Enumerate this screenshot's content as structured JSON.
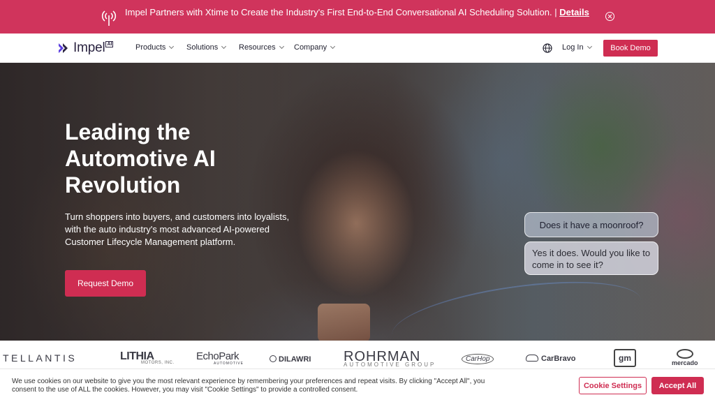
{
  "announcement": {
    "text": "Impel Partners with Xtime to Create the Industry's First End-to-End Conversational AI Scheduling Solution. |",
    "link": "Details"
  },
  "nav": {
    "logo_text": "Impel",
    "logo_badge": "AI",
    "menu": [
      {
        "label": "Products"
      },
      {
        "label": "Solutions"
      },
      {
        "label": "Resources"
      },
      {
        "label": "Company"
      }
    ],
    "login": "Log In",
    "cta": "Book Demo"
  },
  "hero": {
    "headline": "Leading the Automotive AI Revolution",
    "subheadline": "Turn shoppers into buyers, and customers into loyalists, with the auto industry's most advanced AI-powered Customer Lifecycle Management platform.",
    "cta": "Request Demo",
    "chat": {
      "question": "Does it have a moonroof?",
      "answer": "Yes it does. Would you like to come in to see it?"
    }
  },
  "partners": {
    "tellantis": "TELLANTIS",
    "lithia": "LITHIA",
    "lithia_sub": "MOTORS, INC.",
    "echopark": "EchoPark",
    "echopark_sub": "AUTOMOTIVE",
    "dilawri": "DILAWRI",
    "rohrman": "ROHRMAN",
    "rohrman_sub": "AUTOMOTIVE GROUP",
    "carhop": "CarHop",
    "carbravo": "CarBravo",
    "gm": "gm",
    "mercado": "mercado"
  },
  "cookie": {
    "text": "We use cookies on our website to give you the most relevant experience by remembering your preferences and repeat visits. By clicking \"Accept All\", you consent to the use of ALL the cookies. However, you may visit \"Cookie Settings\" to provide a controlled consent.",
    "settings": "Cookie Settings",
    "accept": "Accept All"
  },
  "colors": {
    "brand": "#cf2d52",
    "announcement_bg": "#d0345c"
  }
}
